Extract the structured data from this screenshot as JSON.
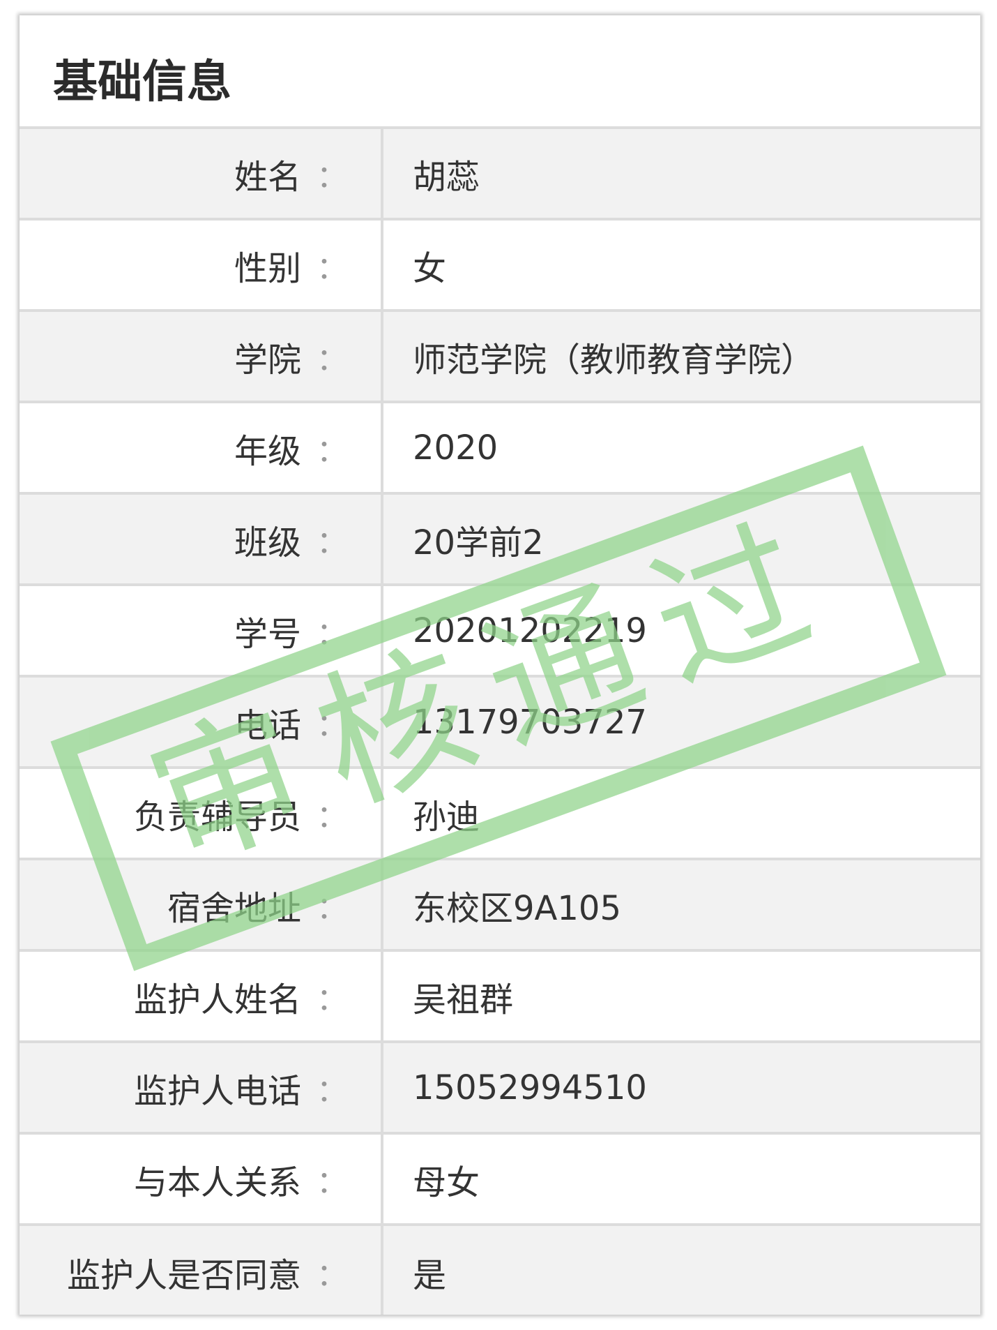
{
  "card": {
    "title": "基础信息"
  },
  "fields": [
    {
      "label": "姓名",
      "value": "胡蕊"
    },
    {
      "label": "性别",
      "value": "女"
    },
    {
      "label": "学院",
      "value": "师范学院（教师教育学院）"
    },
    {
      "label": "年级",
      "value": "2020"
    },
    {
      "label": "班级",
      "value": "20学前2"
    },
    {
      "label": "学号",
      "value": "20201202219"
    },
    {
      "label": "电话",
      "value": "13179703727"
    },
    {
      "label": "负责辅导员",
      "value": "孙迪"
    },
    {
      "label": "宿舍地址",
      "value": "东校区9A105"
    },
    {
      "label": "监护人姓名",
      "value": "吴祖群"
    },
    {
      "label": "监护人电话",
      "value": "15052994510"
    },
    {
      "label": "与本人关系",
      "value": "母女"
    },
    {
      "label": "监护人是否同意",
      "value": "是"
    }
  ],
  "separator": "：",
  "stamp": {
    "text": "审核通过",
    "color": "#8fd48a"
  }
}
